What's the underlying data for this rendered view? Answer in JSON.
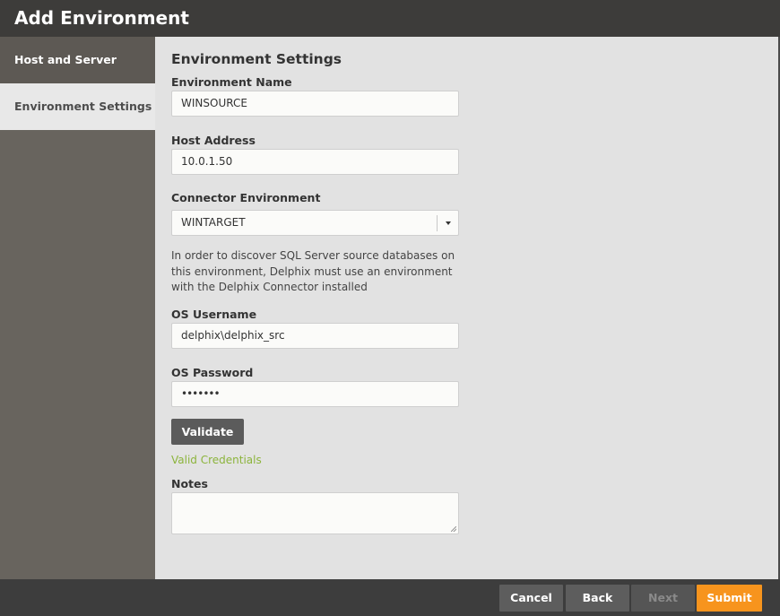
{
  "window": {
    "title": "Add Environment"
  },
  "sidebar": {
    "items": [
      {
        "label": "Host and Server",
        "active": false
      },
      {
        "label": "Environment Settings",
        "active": true
      }
    ]
  },
  "form": {
    "section_title": "Environment Settings",
    "environment_name": {
      "label": "Environment Name",
      "value": "WINSOURCE"
    },
    "host_address": {
      "label": "Host Address",
      "value": "10.0.1.50"
    },
    "connector_environment": {
      "label": "Connector Environment",
      "value": "WINTARGET"
    },
    "help_text": "In order to discover SQL Server source databases on this environment, Delphix must use an environment with the Delphix Connector installed",
    "os_username": {
      "label": "OS Username",
      "value": "delphix\\delphix_src"
    },
    "os_password": {
      "label": "OS Password",
      "value": "•••••••"
    },
    "validate_label": "Validate",
    "valid_message": "Valid Credentials",
    "notes": {
      "label": "Notes",
      "value": ""
    }
  },
  "footer": {
    "cancel_label": "Cancel",
    "back_label": "Back",
    "next_label": "Next",
    "submit_label": "Submit"
  },
  "colors": {
    "accent": "#f7941d",
    "success": "#8cb43c",
    "sidebar_bg": "#68645e",
    "titlebar_bg": "#3d3c3a"
  }
}
